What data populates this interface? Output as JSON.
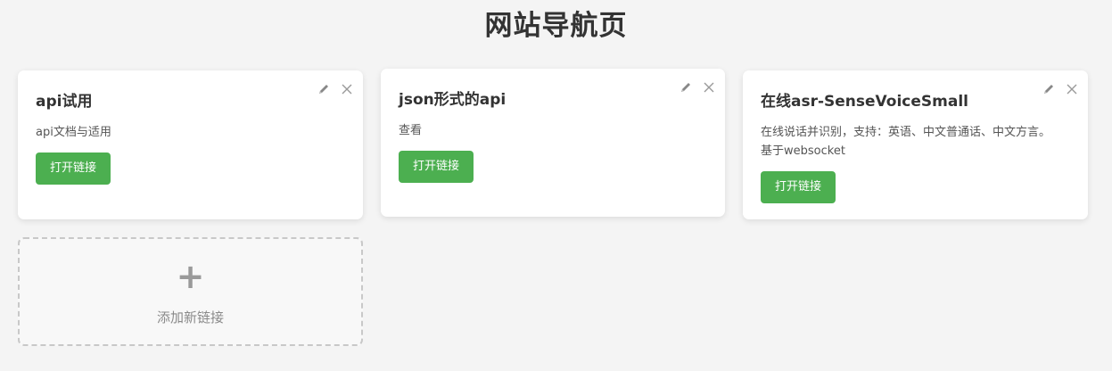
{
  "page": {
    "title": "网站导航页"
  },
  "cards": [
    {
      "title": "api试用",
      "description": "api文档与适用",
      "button_label": "打开链接",
      "edit_icon": "pencil-icon",
      "delete_icon": "close-icon"
    },
    {
      "title": "json形式的api",
      "description": "查看",
      "button_label": "打开链接",
      "edit_icon": "pencil-icon",
      "delete_icon": "close-icon"
    },
    {
      "title": "在线asr-SenseVoiceSmall",
      "description": "在线说话并识别，支持：英语、中文普通话、中文方言。基于websocket",
      "button_label": "打开链接",
      "edit_icon": "pencil-icon",
      "delete_icon": "close-icon"
    }
  ],
  "add_card": {
    "icon": "plus-icon",
    "plus_symbol": "+",
    "label": "添加新链接"
  },
  "colors": {
    "background": "#f4f4f4",
    "card": "#ffffff",
    "button": "#4caf50",
    "button_text": "#ffffff",
    "icon": "#999999",
    "dashed_border": "#c8c8c8"
  }
}
